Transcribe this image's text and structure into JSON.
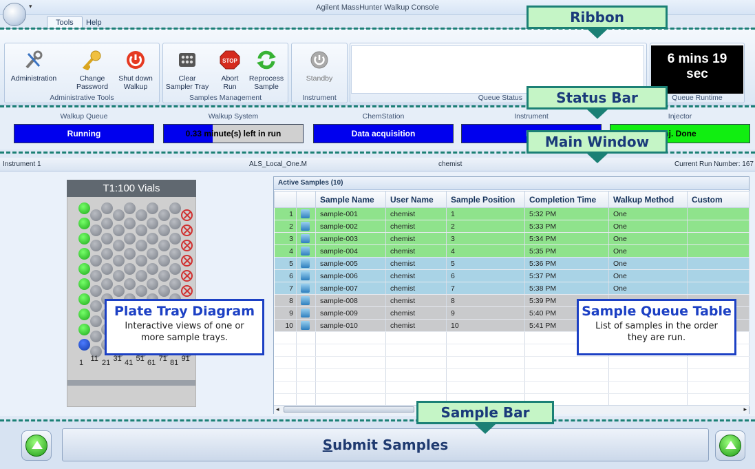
{
  "window": {
    "title": "Agilent MassHunter Walkup Console"
  },
  "tabs": [
    {
      "label": "Tools"
    },
    {
      "label": "Help"
    }
  ],
  "ribbon": {
    "admin_group": {
      "label": "Administrative Tools",
      "buttons": [
        {
          "label1": "Administration",
          "label2": ""
        },
        {
          "label1": "Change",
          "label2": "Password"
        },
        {
          "label1": "Shut down",
          "label2": "Walkup"
        }
      ]
    },
    "samples_group": {
      "label": "Samples Management",
      "buttons": [
        {
          "label1": "Clear",
          "label2": "Sampler Tray"
        },
        {
          "label1": "Abort",
          "label2": "Run"
        },
        {
          "label1": "Reprocess",
          "label2": "Sample"
        }
      ]
    },
    "instrument_group": {
      "label": "Instrument",
      "buttons": [
        {
          "label1": "Standby",
          "label2": ""
        }
      ]
    },
    "queue_status": {
      "label": "Queue Status"
    },
    "queue_runtime": {
      "label": "Queue Runtime",
      "line1": "6 mins 19",
      "line2": "sec"
    }
  },
  "status_bar": [
    {
      "header": "Walkup Queue",
      "value": "Running",
      "color": "#0000ee"
    },
    {
      "header": "Walkup System",
      "value": "0.33 minute(s) left in run",
      "progress": 0.35,
      "fill": "#0000ee",
      "rest": "#d0d0d0"
    },
    {
      "header": "ChemStation",
      "value": "Data acquisition",
      "color": "#0000ee"
    },
    {
      "header": "Instrument",
      "value": "Ru",
      "color": "#0000ee"
    },
    {
      "header": "Injector",
      "value": "nj. Done",
      "color": "#11ee11"
    }
  ],
  "info_bar": {
    "instrument": "Instrument 1",
    "method": "ALS_Local_One.M",
    "user": "chemist",
    "run_number": "Current Run Number: 167"
  },
  "tray": {
    "title": "T1:100 Vials",
    "numbers": [
      "1",
      "11",
      "21",
      "31",
      "41",
      "51",
      "61",
      "71",
      "81",
      "91"
    ]
  },
  "samples": {
    "title": "Active Samples (10)",
    "columns": [
      "",
      "",
      "Sample Name",
      "User Name",
      "Sample Position",
      "Completion Time",
      "Walkup Method",
      "Custom"
    ],
    "rows": [
      {
        "n": "1",
        "name": "sample-001",
        "user": "chemist",
        "pos": "1",
        "time": "5:32 PM",
        "method": "One",
        "status": "green"
      },
      {
        "n": "2",
        "name": "sample-002",
        "user": "chemist",
        "pos": "2",
        "time": "5:33 PM",
        "method": "One",
        "status": "green"
      },
      {
        "n": "3",
        "name": "sample-003",
        "user": "chemist",
        "pos": "3",
        "time": "5:34 PM",
        "method": "One",
        "status": "green"
      },
      {
        "n": "4",
        "name": "sample-004",
        "user": "chemist",
        "pos": "4",
        "time": "5:35 PM",
        "method": "One",
        "status": "green"
      },
      {
        "n": "5",
        "name": "sample-005",
        "user": "chemist",
        "pos": "5",
        "time": "5:36 PM",
        "method": "One",
        "status": "blue"
      },
      {
        "n": "6",
        "name": "sample-006",
        "user": "chemist",
        "pos": "6",
        "time": "5:37 PM",
        "method": "One",
        "status": "blue"
      },
      {
        "n": "7",
        "name": "sample-007",
        "user": "chemist",
        "pos": "7",
        "time": "5:38 PM",
        "method": "One",
        "status": "blue"
      },
      {
        "n": "8",
        "name": "sample-008",
        "user": "chemist",
        "pos": "8",
        "time": "5:39 PM",
        "method": "",
        "status": "gray"
      },
      {
        "n": "9",
        "name": "sample-009",
        "user": "chemist",
        "pos": "9",
        "time": "5:40 PM",
        "method": "",
        "status": "gray"
      },
      {
        "n": "10",
        "name": "sample-010",
        "user": "chemist",
        "pos": "10",
        "time": "5:41 PM",
        "method": "",
        "status": "gray"
      }
    ]
  },
  "sample_bar": {
    "submit_letter": "S",
    "submit_rest": "ubmit Samples"
  },
  "annotations": {
    "ribbon": "Ribbon",
    "status_bar": "Status Bar",
    "main_window": "Main Window",
    "sample_bar": "Sample Bar",
    "plate_tray": {
      "title": "Plate Tray Diagram",
      "body": "Interactive views of one or more sample trays."
    },
    "queue_table": {
      "title": "Sample Queue Table",
      "body": "List of samples in the order they are run."
    },
    "accent": "#1b8075",
    "info_color": "#1c40c4"
  }
}
